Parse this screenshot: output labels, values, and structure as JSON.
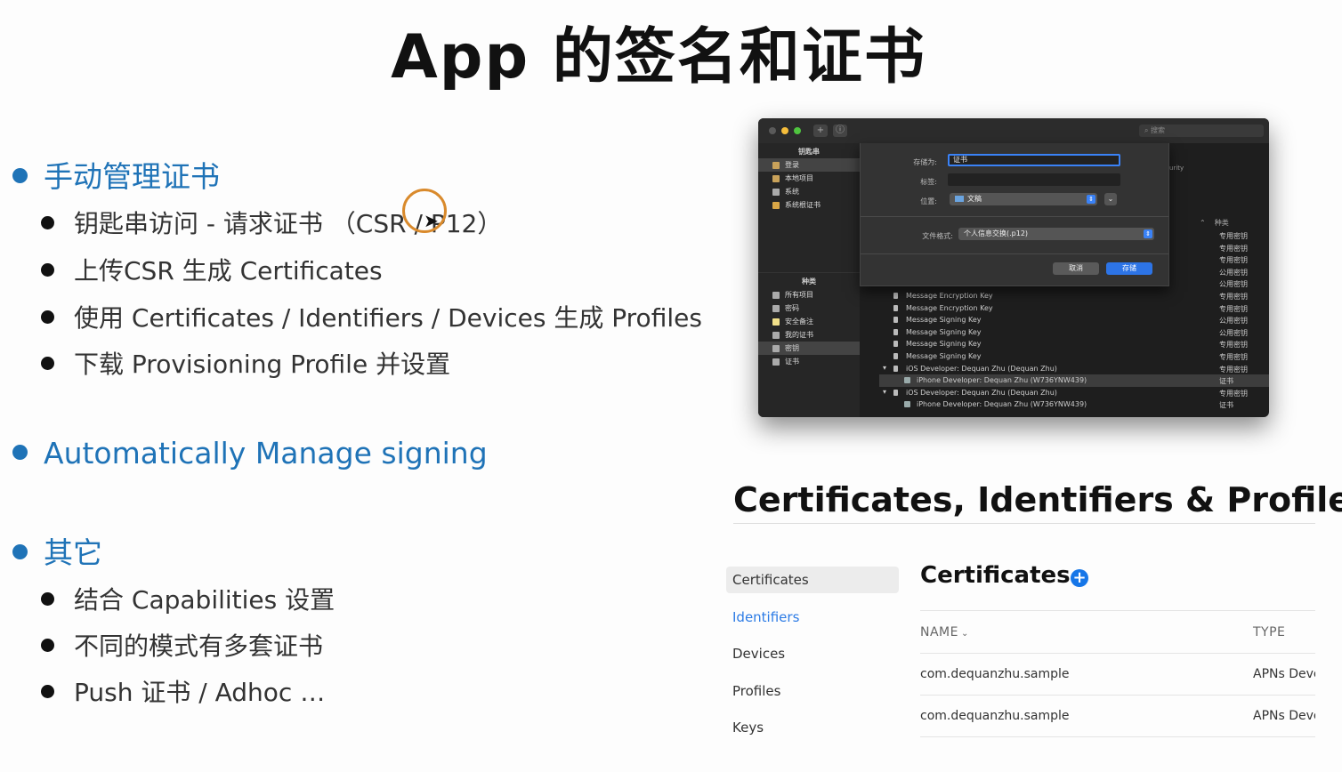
{
  "title": "App 的签名和证书",
  "bullets": {
    "group1": {
      "heading": "手动管理证书",
      "items": [
        "钥匙串访问 - 请求证书 （CSR / P12）",
        "上传CSR 生成 Certificates",
        "使用 Certificates / Identifiers / Devices 生成 Profiles",
        "下载 Provisioning Profile 并设置"
      ]
    },
    "group2": {
      "heading": "Automatically Manage signing"
    },
    "group3": {
      "heading": "其它",
      "items": [
        "结合 Capabilities 设置",
        "不同的模式有多套证书",
        "Push 证书 / Adhoc …"
      ]
    }
  },
  "keychain": {
    "search": "搜索",
    "sidebar": {
      "keychains_header": "钥匙串",
      "keychains": [
        "登录",
        "本地项目",
        "系统",
        "系统根证书"
      ],
      "category_header": "种类",
      "categories": [
        "所有项目",
        "密码",
        "安全备注",
        "我的证书",
        "密钥",
        "证书"
      ]
    },
    "dialog": {
      "save_as_label": "存储为:",
      "save_as_value": "证书",
      "tags_label": "标签:",
      "where_label": "位置:",
      "where_value": "文稿",
      "format_label": "文件格式:",
      "format_value": "个人信息交换(.p12)",
      "cancel": "取消",
      "save": "存储"
    },
    "side_fragment": "urity",
    "type_header": "种类",
    "rows": [
      {
        "name": "",
        "type": "专用密钥"
      },
      {
        "name": "",
        "type": "专用密钥"
      },
      {
        "name": "",
        "type": "专用密钥"
      },
      {
        "name": "",
        "type": "公用密钥"
      },
      {
        "name": "",
        "type": "公用密钥"
      },
      {
        "name": "Message Encryption Key",
        "type": "专用密钥"
      },
      {
        "name": "Message Encryption Key",
        "type": "专用密钥"
      },
      {
        "name": "Message Signing Key",
        "type": "公用密钥"
      },
      {
        "name": "Message Signing Key",
        "type": "公用密钥"
      },
      {
        "name": "Message Signing Key",
        "type": "专用密钥"
      },
      {
        "name": "Message Signing Key",
        "type": "专用密钥"
      },
      {
        "name": "iOS Developer: Dequan Zhu (Dequan Zhu)",
        "type": "专用密钥"
      },
      {
        "name": "iPhone Developer: Dequan Zhu (W736YNW439)",
        "type": "证书"
      },
      {
        "name": "iOS Developer: Dequan Zhu (Dequan Zhu)",
        "type": "专用密钥"
      },
      {
        "name": "iPhone Developer: Dequan Zhu (W736YNW439)",
        "type": "证书"
      }
    ]
  },
  "developer": {
    "title": "Certificates, Identifiers & Profiles",
    "nav": [
      "Certificates",
      "Identifiers",
      "Devices",
      "Profiles",
      "Keys"
    ],
    "section_title": "Certificates",
    "add_symbol": "+",
    "columns": {
      "name": "NAME",
      "type": "TYPE"
    },
    "rows": [
      {
        "name": "com.dequanzhu.sample",
        "type": "APNs Development"
      },
      {
        "name": "com.dequanzhu.sample",
        "type": "APNs Development"
      }
    ]
  }
}
